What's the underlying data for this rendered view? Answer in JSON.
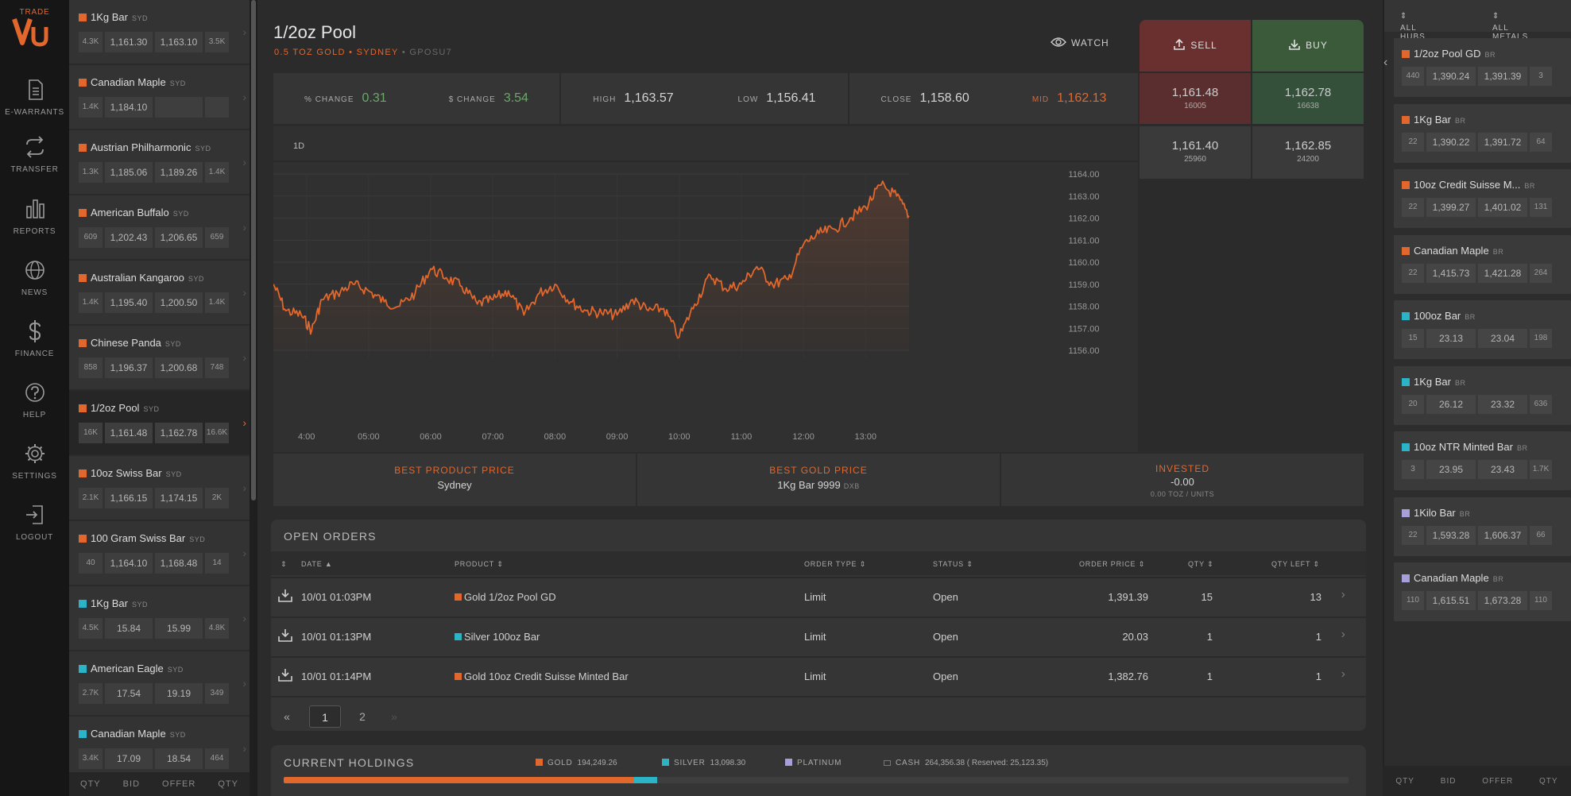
{
  "nav": {
    "logo_text": "Vu",
    "items": [
      {
        "label": "TRADE",
        "icon": "vu-logo"
      },
      {
        "label": "E-WARRANTS",
        "icon": "document-icon"
      },
      {
        "label": "TRANSFER",
        "icon": "transfer-icon"
      },
      {
        "label": "REPORTS",
        "icon": "bar-chart-icon"
      },
      {
        "label": "NEWS",
        "icon": "globe-icon"
      },
      {
        "label": "FINANCE",
        "icon": "dollar-icon"
      },
      {
        "label": "HELP",
        "icon": "help-icon"
      },
      {
        "label": "SETTINGS",
        "icon": "gear-icon"
      },
      {
        "label": "LOGOUT",
        "icon": "logout-icon"
      }
    ]
  },
  "products": [
    {
      "name": "1Kg Bar",
      "hub": "SYD",
      "metal": "gold",
      "q1": "4.3K",
      "bid": "1,161.30",
      "offer": "1,163.10",
      "q2": "3.5K"
    },
    {
      "name": "Canadian Maple",
      "hub": "SYD",
      "metal": "gold",
      "q1": "1.4K",
      "bid": "1,184.10",
      "offer": "",
      "q2": ""
    },
    {
      "name": "Austrian Philharmonic",
      "hub": "SYD",
      "metal": "gold",
      "q1": "1.3K",
      "bid": "1,185.06",
      "offer": "1,189.26",
      "q2": "1.4K"
    },
    {
      "name": "American Buffalo",
      "hub": "SYD",
      "metal": "gold",
      "q1": "609",
      "bid": "1,202.43",
      "offer": "1,206.65",
      "q2": "659"
    },
    {
      "name": "Australian Kangaroo",
      "hub": "SYD",
      "metal": "gold",
      "q1": "1.4K",
      "bid": "1,195.40",
      "offer": "1,200.50",
      "q2": "1.4K"
    },
    {
      "name": "Chinese Panda",
      "hub": "SYD",
      "metal": "gold",
      "q1": "858",
      "bid": "1,196.37",
      "offer": "1,200.68",
      "q2": "748"
    },
    {
      "name": "1/2oz Pool",
      "hub": "SYD",
      "metal": "gold",
      "q1": "16K",
      "bid": "1,161.48",
      "offer": "1,162.78",
      "q2": "16.6K",
      "active": true
    },
    {
      "name": "10oz Swiss Bar",
      "hub": "SYD",
      "metal": "gold",
      "q1": "2.1K",
      "bid": "1,166.15",
      "offer": "1,174.15",
      "q2": "2K"
    },
    {
      "name": "100 Gram Swiss Bar",
      "hub": "SYD",
      "metal": "gold",
      "q1": "40",
      "bid": "1,164.10",
      "offer": "1,168.48",
      "q2": "14"
    },
    {
      "name": "1Kg Bar",
      "hub": "SYD",
      "metal": "silver",
      "q1": "4.5K",
      "bid": "15.84",
      "offer": "15.99",
      "q2": "4.8K"
    },
    {
      "name": "American Eagle",
      "hub": "SYD",
      "metal": "silver",
      "q1": "2.7K",
      "bid": "17.54",
      "offer": "19.19",
      "q2": "349"
    },
    {
      "name": "Canadian Maple",
      "hub": "SYD",
      "metal": "silver",
      "q1": "3.4K",
      "bid": "17.09",
      "offer": "18.54",
      "q2": "464"
    }
  ],
  "list_footer": {
    "qty": "QTY",
    "bid": "BID",
    "offer": "OFFER",
    "qty2": "QTY"
  },
  "header": {
    "title": "1/2oz Pool",
    "subtitle": "0.5 TOZ GOLD • SYDNEY",
    "code": "• GPOSU7",
    "watch_label": "WATCH"
  },
  "actions": {
    "sell_label": "SELL",
    "buy_label": "BUY"
  },
  "stats": {
    "pct_change_label": "% CHANGE",
    "pct_change": "0.31",
    "usd_change_label": "$ CHANGE",
    "usd_change": "3.54",
    "high_label": "HIGH",
    "high": "1,163.57",
    "low_label": "LOW",
    "low": "1,156.41",
    "close_label": "CLOSE",
    "close": "1,158.60",
    "mid_label": "MID",
    "mid": "1,162.13"
  },
  "quotes": {
    "sell1_price": "1,161.48",
    "sell1_qty": "16005",
    "buy1_price": "1,162.78",
    "buy1_qty": "16638",
    "sell2_price": "1,161.40",
    "sell2_qty": "25960",
    "buy2_price": "1,162.85",
    "buy2_qty": "24200"
  },
  "chart_range": "1D",
  "chart_data": {
    "type": "line",
    "title": "",
    "xlabel": "",
    "ylabel": "",
    "x_ticks": [
      "4:00",
      "05:00",
      "06:00",
      "07:00",
      "08:00",
      "09:00",
      "10:00",
      "11:00",
      "12:00",
      "13:00"
    ],
    "y_ticks": [
      "1156.00",
      "1157.00",
      "1158.00",
      "1159.00",
      "1160.00",
      "1161.00",
      "1162.00",
      "1163.00",
      "1164.00"
    ],
    "xlim": [
      "03:28",
      "13:42"
    ],
    "ylim": [
      1156,
      1164
    ],
    "grid": true,
    "series": [
      {
        "color": "#e2672d",
        "x": [
          "03:28",
          "03:40",
          "03:55",
          "04:05",
          "04:15",
          "04:30",
          "04:45",
          "05:00",
          "05:15",
          "05:30",
          "05:45",
          "06:00",
          "06:15",
          "06:30",
          "06:45",
          "07:00",
          "07:15",
          "07:30",
          "07:45",
          "08:00",
          "08:15",
          "08:30",
          "08:45",
          "09:00",
          "09:15",
          "09:30",
          "09:45",
          "10:00",
          "10:15",
          "10:30",
          "10:45",
          "11:00",
          "11:15",
          "11:30",
          "11:45",
          "12:00",
          "12:15",
          "12:30",
          "12:45",
          "13:00",
          "13:15",
          "13:30",
          "13:42"
        ],
        "values": [
          1159.0,
          1157.8,
          1157.6,
          1156.9,
          1158.3,
          1158.6,
          1159.0,
          1158.7,
          1158.2,
          1158.0,
          1158.6,
          1159.7,
          1159.3,
          1158.9,
          1158.1,
          1158.3,
          1158.7,
          1157.6,
          1158.6,
          1159.0,
          1158.2,
          1157.8,
          1157.7,
          1157.6,
          1158.3,
          1157.8,
          1157.9,
          1156.6,
          1158.1,
          1159.4,
          1158.8,
          1159.0,
          1159.8,
          1159.0,
          1159.2,
          1160.8,
          1161.3,
          1161.5,
          1162.0,
          1162.5,
          1163.5,
          1163.0,
          1162.1
        ]
      }
    ]
  },
  "info_bar": {
    "best_product_label": "BEST PRODUCT PRICE",
    "best_product_value": "Sydney",
    "best_gold_label": "BEST GOLD PRICE",
    "best_gold_value": "1Kg Bar 9999",
    "best_gold_hub": "DXB",
    "invested_label": "INVESTED",
    "invested_value": "-0.00",
    "invested_sub": "0.00 TOZ / UNITS"
  },
  "orders": {
    "title": "OPEN ORDERS",
    "columns": [
      "DATE",
      "PRODUCT",
      "ORDER TYPE",
      "STATUS",
      "ORDER PRICE",
      "QTY",
      "QTY LEFT"
    ],
    "rows": [
      {
        "date": "10/01 01:03PM",
        "metal": "gold",
        "product": "Gold 1/2oz Pool GD",
        "type": "Limit",
        "status": "Open",
        "price": "1,391.39",
        "qty": "15",
        "left": "13"
      },
      {
        "date": "10/01 01:13PM",
        "metal": "silver",
        "product": "Silver 100oz Bar",
        "type": "Limit",
        "status": "Open",
        "price": "20.03",
        "qty": "1",
        "left": "1"
      },
      {
        "date": "10/01 01:14PM",
        "metal": "gold",
        "product": "Gold 10oz Credit Suisse Minted Bar",
        "type": "Limit",
        "status": "Open",
        "price": "1,382.76",
        "qty": "1",
        "left": "1"
      }
    ],
    "pager": {
      "prev": "«",
      "page1": "1",
      "page2": "2",
      "next": "»"
    }
  },
  "holdings": {
    "title": "CURRENT HOLDINGS",
    "gold_label": "GOLD",
    "gold_value": "194,249.26",
    "silver_label": "SILVER",
    "silver_value": "13,098.30",
    "platinum_label": "PLATINUM",
    "cash_label": "CASH",
    "cash_value": "264,356.38 ( Reserved: 25,123.35)",
    "gold_fraction": 0.329,
    "silver_fraction": 0.022
  },
  "right_panel": {
    "hubs_label": "ALL HUBS",
    "metals_label": "ALL METALS",
    "items": [
      {
        "name": "1/2oz Pool GD",
        "hub": "BR",
        "metal": "gold",
        "q1": "440",
        "bid": "1,390.24",
        "offer": "1,391.39",
        "q2": "3"
      },
      {
        "name": "1Kg Bar",
        "hub": "BR",
        "metal": "gold",
        "q1": "22",
        "bid": "1,390.22",
        "offer": "1,391.72",
        "q2": "64"
      },
      {
        "name": "10oz Credit Suisse M...",
        "hub": "BR",
        "metal": "gold",
        "q1": "22",
        "bid": "1,399.27",
        "offer": "1,401.02",
        "q2": "131"
      },
      {
        "name": "Canadian Maple",
        "hub": "BR",
        "metal": "gold",
        "q1": "22",
        "bid": "1,415.73",
        "offer": "1,421.28",
        "q2": "264"
      },
      {
        "name": "100oz Bar",
        "hub": "BR",
        "metal": "silver",
        "q1": "15",
        "bid": "23.13",
        "offer": "23.04",
        "q2": "198"
      },
      {
        "name": "1Kg Bar",
        "hub": "BR",
        "metal": "silver",
        "q1": "20",
        "bid": "26.12",
        "offer": "23.32",
        "q2": "636"
      },
      {
        "name": "10oz NTR Minted Bar",
        "hub": "BR",
        "metal": "silver",
        "q1": "3",
        "bid": "23.95",
        "offer": "23.43",
        "q2": "1.7K"
      },
      {
        "name": "1Kilo Bar",
        "hub": "BR",
        "metal": "platinum",
        "q1": "22",
        "bid": "1,593.28",
        "offer": "1,606.37",
        "q2": "66"
      },
      {
        "name": "Canadian Maple",
        "hub": "BR",
        "metal": "platinum",
        "q1": "110",
        "bid": "1,615.51",
        "offer": "1,673.28",
        "q2": "110"
      }
    ],
    "footer": {
      "qty": "QTY",
      "bid": "BID",
      "offer": "OFFER",
      "qty2": "QTY"
    }
  },
  "colors": {
    "gold": "#e2672d",
    "silver": "#2bb3c8",
    "platinum": "#a7a0d8",
    "sell": "#6a2f2f",
    "buy": "#3a5a3a",
    "line": "#e2672d"
  }
}
